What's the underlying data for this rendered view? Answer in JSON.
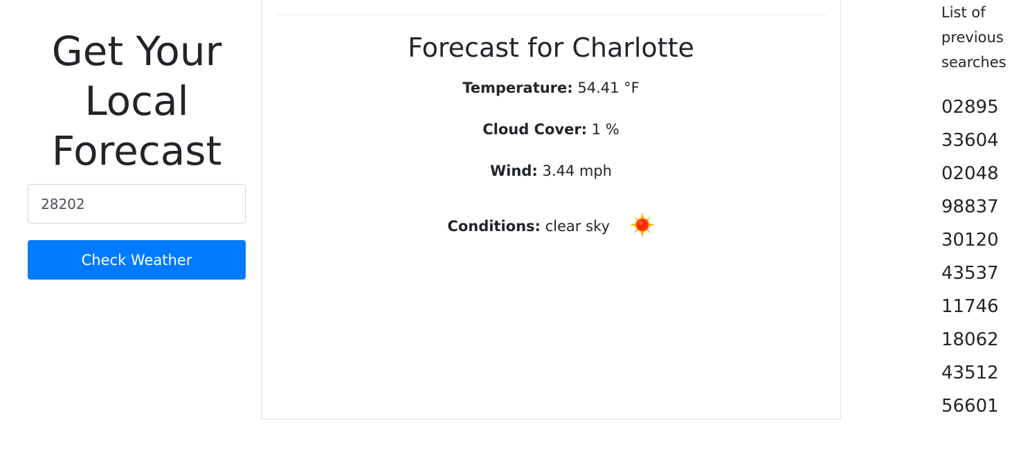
{
  "sidebar": {
    "heading": "Get Your Local Forecast",
    "zip_input_value": "28202",
    "check_button_label": "Check Weather"
  },
  "forecast": {
    "title": "Forecast for Charlotte",
    "temperature_label": "Temperature:",
    "temperature_value": "54.41 °F",
    "cloud_label": "Cloud Cover:",
    "cloud_value": "1 %",
    "wind_label": "Wind:",
    "wind_value": "3.44 mph",
    "conditions_label": "Conditions:",
    "conditions_value": "clear sky",
    "conditions_icon": "sun-icon"
  },
  "history": {
    "heading": "List of previous searches",
    "items": [
      "02895",
      "33604",
      "02048",
      "98837",
      "30120",
      "43537",
      "11746",
      "18062",
      "43512",
      "56601"
    ]
  },
  "colors": {
    "primary_button": "#007bff",
    "text": "#212529",
    "sun_core": "#ff2a00",
    "sun_rays": "#ffb400"
  }
}
